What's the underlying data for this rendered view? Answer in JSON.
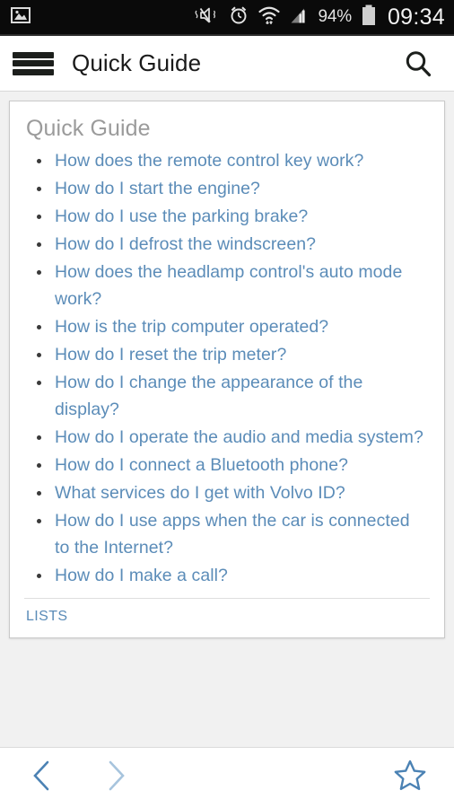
{
  "statusbar": {
    "left_icons": [
      {
        "name": "image-icon",
        "glyph": "picture"
      }
    ],
    "right_icons": [
      {
        "name": "mute-vibrate-icon",
        "glyph": "speaker-muted"
      },
      {
        "name": "alarm-icon",
        "glyph": "alarm-clock"
      },
      {
        "name": "wifi-icon",
        "glyph": "wifi"
      },
      {
        "name": "signal-icon",
        "glyph": "cellular-bars"
      }
    ],
    "battery_percent": "94%",
    "battery_icon_name": "battery-icon",
    "clock": "09:34",
    "background_color": "#0a0a0a",
    "text_color": "#e8e8e8"
  },
  "appbar": {
    "menu_icon_name": "hamburger-menu-icon",
    "title": "Quick Guide",
    "search_icon_name": "search-icon",
    "background_color": "#ffffff",
    "title_color": "#1a1a1a"
  },
  "card": {
    "title": "Quick Guide",
    "title_color": "#9b9b9b",
    "link_color": "#5b8cb8",
    "items": [
      "How does the remote control key work?",
      "How do I start the engine?",
      "How do I use the parking brake?",
      "How do I defrost the windscreen?",
      "How does the headlamp control's auto mode work?",
      "How is the trip computer operated?",
      "How do I reset the trip meter?",
      "How do I change the appearance of the display?",
      "How do I operate the audio and media system?",
      "How do I connect a Bluetooth phone?",
      "What services do I get with Volvo ID?",
      "How do I use apps when the car is connected to the Internet?",
      "How do I make a call?"
    ],
    "footer_link": "LISTS"
  },
  "bottombar": {
    "back_icon_name": "chevron-left-icon",
    "forward_icon_name": "chevron-right-icon",
    "favorite_icon_name": "star-outline-icon",
    "back_color": "#4b82b4",
    "forward_color": "#a7c4dd",
    "favorite_color": "#4b82b4",
    "background_color": "#ffffff"
  },
  "page": {
    "background_color": "#f1f1f1"
  }
}
